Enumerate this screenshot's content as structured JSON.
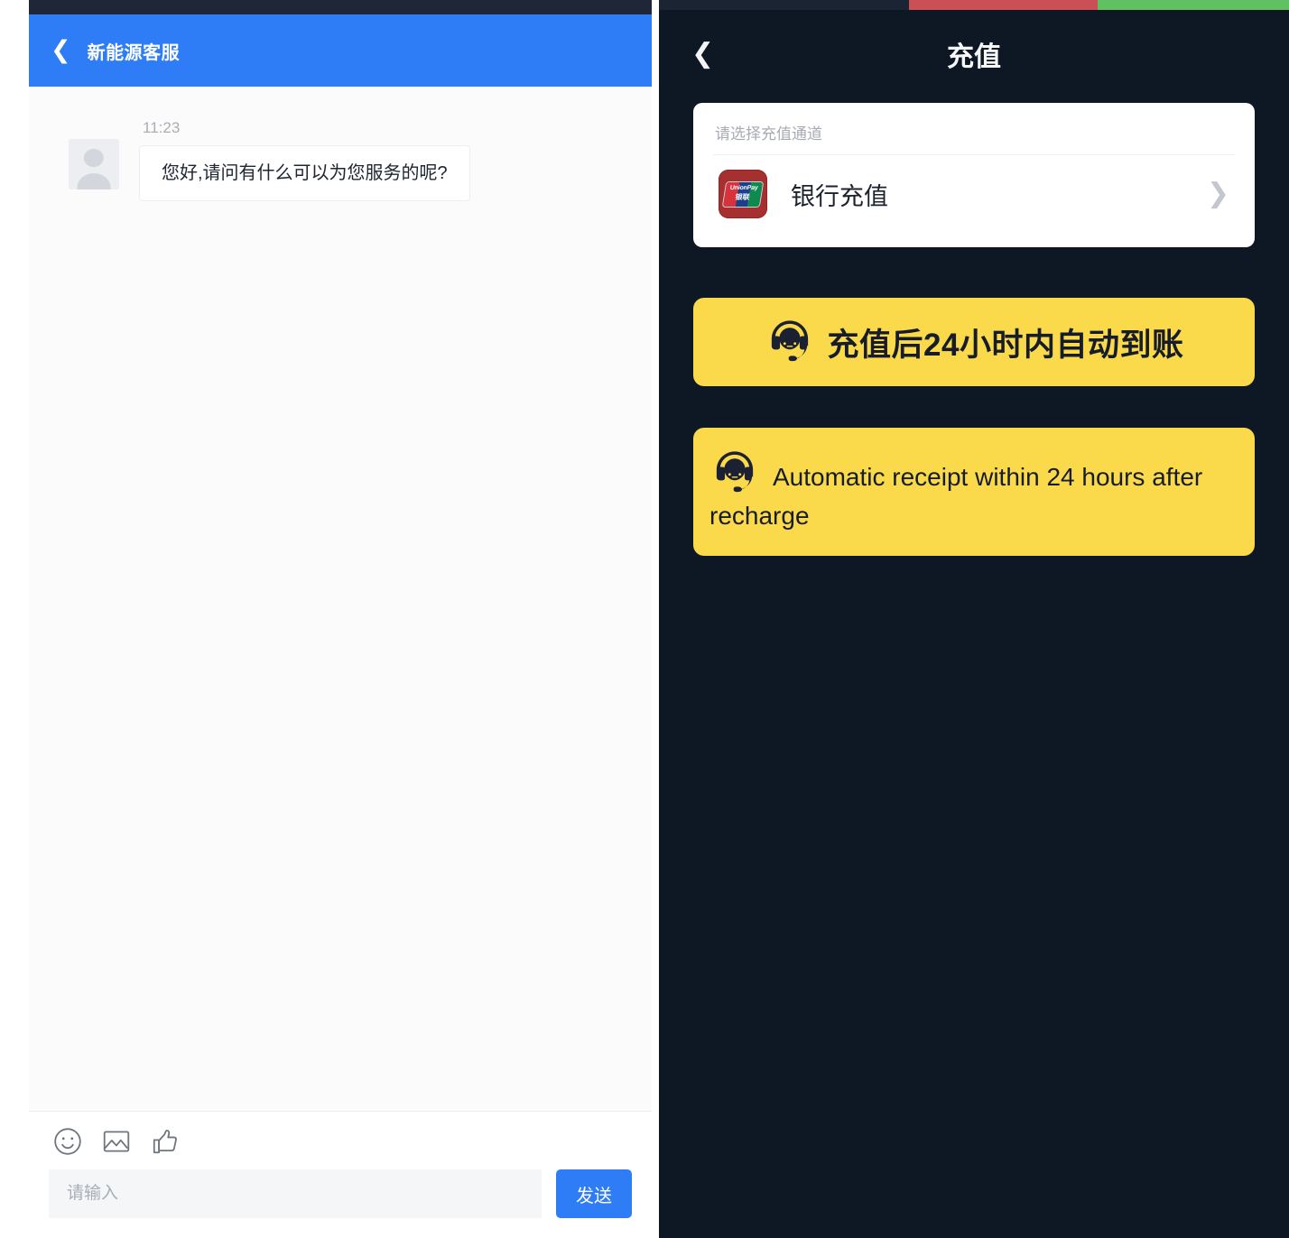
{
  "chat": {
    "header": {
      "back_icon": "chevron-left-icon",
      "title": "新能源客服"
    },
    "messages": [
      {
        "time": "11:23",
        "text": "您好,请问有什么可以为您服务的呢?",
        "avatar_icon": "default-user-avatar"
      }
    ],
    "toolbar": [
      {
        "icon": "emoji-icon"
      },
      {
        "icon": "image-icon"
      },
      {
        "icon": "thumbs-up-icon"
      }
    ],
    "input": {
      "value": "",
      "placeholder": "请输入"
    },
    "send_label": "发送",
    "colors": {
      "header_blue": "#2e7df7",
      "statusbar": "#1e2637",
      "body_bg": "#fbfbfb",
      "input_bg": "#f4f6f8"
    }
  },
  "recharge": {
    "statusbar": {
      "base_color": "#1b2433",
      "red_color": "#cb5055",
      "green_color": "#61c162"
    },
    "header": {
      "back_icon": "chevron-left-icon",
      "title": "充值"
    },
    "card": {
      "label": "请选择充值通道",
      "channel": {
        "icon": "unionpay-icon",
        "icon_text_top": "UnionPay",
        "icon_text_bottom": "银联",
        "name": "银行充值",
        "chevron_icon": "chevron-right-icon"
      }
    },
    "banners": [
      {
        "icon": "headset-support-icon",
        "text": "充值后24小时内自动到账"
      },
      {
        "icon": "headset-support-icon",
        "text": "Automatic receipt within 24 hours after recharge"
      }
    ],
    "colors": {
      "panel_bg": "#0e1724",
      "banner_yellow": "#fada4b",
      "banner_text": "#161c2a"
    }
  }
}
